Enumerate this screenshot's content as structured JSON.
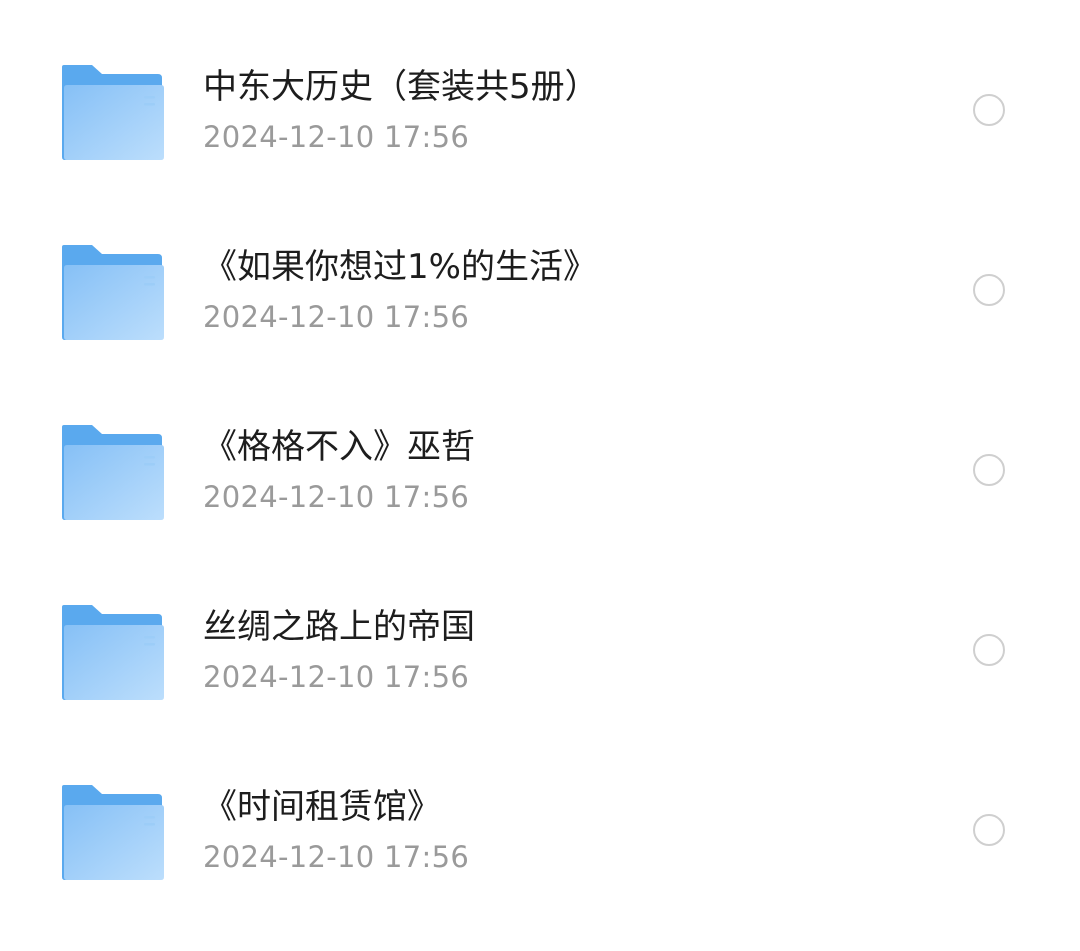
{
  "files": [
    {
      "name": "中东大历史（套装共5册）",
      "date": "2024-12-10 17:56",
      "selected": false,
      "icon": "folder-icon"
    },
    {
      "name": "《如果你想过1%的生活》",
      "date": "2024-12-10 17:56",
      "selected": false,
      "icon": "folder-icon"
    },
    {
      "name": "《格格不入》巫哲",
      "date": "2024-12-10 17:56",
      "selected": false,
      "icon": "folder-icon"
    },
    {
      "name": "丝绸之路上的帝国",
      "date": "2024-12-10 17:56",
      "selected": false,
      "icon": "folder-icon"
    },
    {
      "name": "《时间租赁馆》",
      "date": "2024-12-10 17:56",
      "selected": false,
      "icon": "folder-icon"
    }
  ],
  "colors": {
    "folder_back": "#5aa9ee",
    "folder_front_top": "#8cc4f7",
    "folder_front_bottom": "#b8dcfb",
    "radio_border": "#cfcfcf",
    "name_text": "#1d1d1d",
    "date_text": "#9a9a9a"
  }
}
